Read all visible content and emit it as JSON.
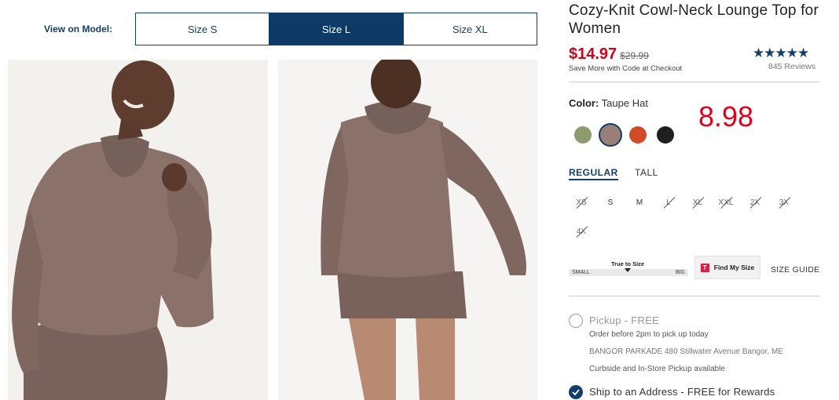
{
  "view_on_model": {
    "label": "View on Model:",
    "tabs": [
      {
        "label": "Size S",
        "active": false
      },
      {
        "label": "Size L",
        "active": true
      },
      {
        "label": "Size XL",
        "active": false
      }
    ]
  },
  "product": {
    "title": "Cozy-Knit Cowl-Neck Lounge Top for Women",
    "price": "$14.97",
    "original_price": "$29.99",
    "promo": "Save More with Code at Checkout",
    "stars": "★★★★★",
    "rating_value": 4.6,
    "reviews": "845 Reviews"
  },
  "color": {
    "label": "Color:",
    "selected": "Taupe Hat",
    "annotation": "8.98",
    "swatches": [
      {
        "name": "olive",
        "hex": "#8f9a6f"
      },
      {
        "name": "taupe",
        "hex": "#9a7e78"
      },
      {
        "name": "orange",
        "hex": "#d14a2a"
      },
      {
        "name": "black",
        "hex": "#1f1f1f"
      }
    ]
  },
  "fit": {
    "tabs": [
      {
        "label": "REGULAR",
        "active": true
      },
      {
        "label": "TALL",
        "active": false
      }
    ]
  },
  "sizes": [
    {
      "label": "XS",
      "available": false
    },
    {
      "label": "S",
      "available": true
    },
    {
      "label": "M",
      "available": true
    },
    {
      "label": "L",
      "available": false
    },
    {
      "label": "XL",
      "available": false
    },
    {
      "label": "XXL",
      "available": false
    },
    {
      "label": "2X",
      "available": false
    },
    {
      "label": "3X",
      "available": false
    },
    {
      "label": "4X",
      "available": false
    }
  ],
  "fit_slider": {
    "label": "True to Size",
    "low": "SMALL",
    "high": "BIG"
  },
  "find_my_size": {
    "label": "Find My Size",
    "logo": "T"
  },
  "size_guide": "SIZE GUIDE",
  "fulfillment": {
    "pickup": {
      "title": "Pickup - FREE",
      "line1": "Order before 2pm to pick up today",
      "line2": "BANGOR PARKADE 480 Stillwater Avenue  Bangor, ME",
      "line3": "Curbside and In-Store Pickup available"
    },
    "ship": {
      "title": "Ship to an Address - FREE for Rewards"
    }
  },
  "colors": {
    "navy": "#123e6b",
    "sale_red": "#d1001f"
  }
}
